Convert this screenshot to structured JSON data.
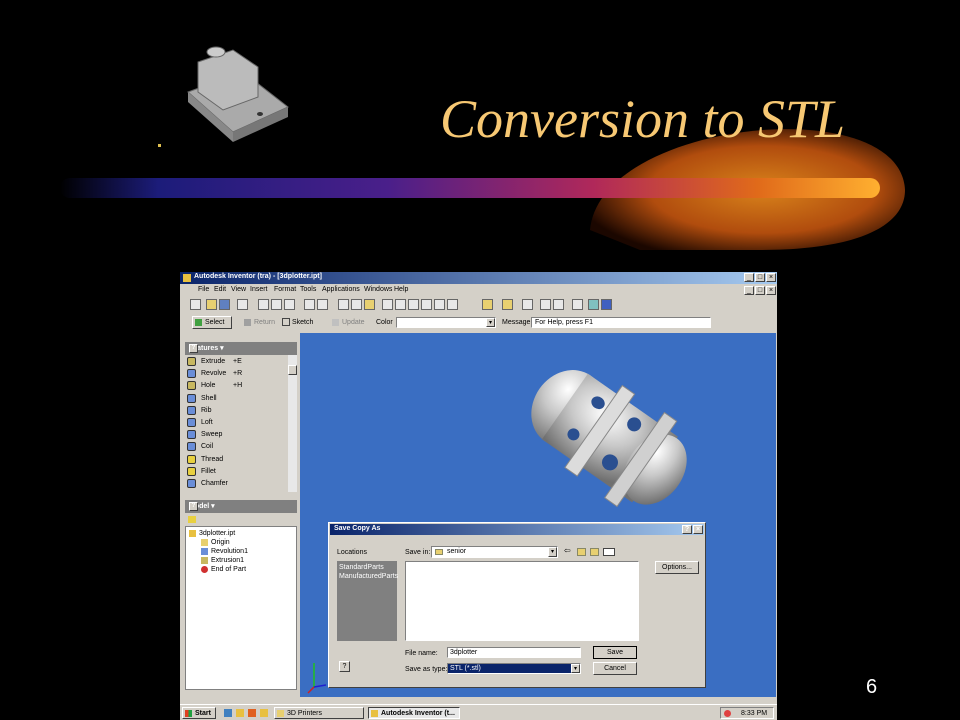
{
  "slide": {
    "title": "Conversion to STL",
    "page_number": "6"
  },
  "window": {
    "title": "Autodesk Inventor (tra) - [3dplotter.ipt]",
    "controls": [
      "_",
      "□",
      "×"
    ],
    "doc_controls": [
      "_",
      "□",
      "×"
    ]
  },
  "menu": [
    "File",
    "Edit",
    "View",
    "Insert",
    "Format",
    "Tools",
    "Applications",
    "Windows",
    "Help"
  ],
  "cmdbar": {
    "select": "Select",
    "return": "Return",
    "sketch": "Sketch",
    "update": "Update",
    "color_label": "Color",
    "color_value": "",
    "message_label": "Message",
    "message_value": "For Help, press F1"
  },
  "features": {
    "title": "Features ▾",
    "help": "?",
    "items": [
      {
        "label": "Extrude",
        "key": "+E",
        "icon": "extrude-icon",
        "color": "#c8b860"
      },
      {
        "label": "Revolve",
        "key": "+R",
        "icon": "revolve-icon",
        "color": "#6a8ed8"
      },
      {
        "label": "Hole",
        "key": "+H",
        "icon": "hole-icon",
        "color": "#c8b860"
      },
      {
        "label": "Shell",
        "key": "",
        "icon": "shell-icon",
        "color": "#6a8ed8"
      },
      {
        "label": "Rib",
        "key": "",
        "icon": "rib-icon",
        "color": "#6a8ed8"
      },
      {
        "label": "Loft",
        "key": "",
        "icon": "loft-icon",
        "color": "#6a8ed8"
      },
      {
        "label": "Sweep",
        "key": "",
        "icon": "sweep-icon",
        "color": "#6a8ed8"
      },
      {
        "label": "Coil",
        "key": "",
        "icon": "coil-icon",
        "color": "#6a8ed8"
      },
      {
        "label": "Thread",
        "key": "",
        "icon": "thread-icon",
        "color": "#e8d040"
      },
      {
        "label": "Fillet",
        "key": "",
        "icon": "fillet-icon",
        "color": "#e8d040"
      },
      {
        "label": "Chamfer",
        "key": "",
        "icon": "chamfer-icon",
        "color": "#6a8ed8"
      }
    ]
  },
  "model": {
    "title": "Model ▾",
    "help": "?",
    "tree": [
      {
        "label": "3dplotter.ipt",
        "indent": 0
      },
      {
        "label": "Origin",
        "indent": 1
      },
      {
        "label": "Revolution1",
        "indent": 1
      },
      {
        "label": "Extrusion1",
        "indent": 1
      },
      {
        "label": "End of Part",
        "indent": 1
      }
    ]
  },
  "dialog": {
    "title": "Save Copy As",
    "locations_label": "Locations",
    "locations": [
      "StandardParts",
      "ManufacturedParts"
    ],
    "save_in_label": "Save in:",
    "save_in_value": "senior",
    "options_button": "Options...",
    "file_name_label": "File name:",
    "file_name_value": "3dplotter",
    "save_as_type_label": "Save as type:",
    "save_as_type_value": "STL (*.stl)",
    "save_button": "Save",
    "cancel_button": "Cancel",
    "help": "?"
  },
  "taskbar": {
    "start": "Start",
    "tasks": [
      "3D Printers",
      "Autodesk Inventor (t..."
    ],
    "clock": "8:33 PM"
  },
  "colors": {
    "title_text": "#f7c873",
    "viewport": "#3a6ec2",
    "titlebar": "#0a246a"
  }
}
